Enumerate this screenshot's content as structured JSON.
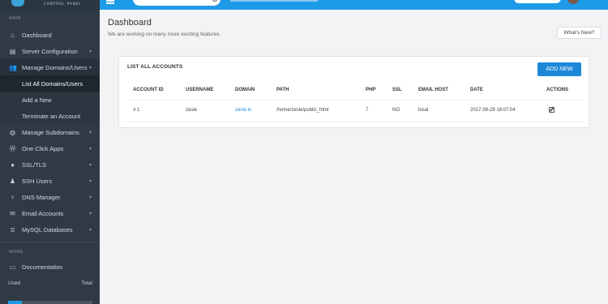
{
  "topbar": {
    "logo_subtitle": "CONTROL PANEL",
    "search_placeholder": ""
  },
  "sidebar": {
    "heading_main": "MAIN",
    "items": [
      {
        "label": "Dashboard",
        "icon": "home-icon"
      },
      {
        "label": "Server Configuration",
        "icon": "server-icon"
      },
      {
        "label": "Manage Domains/Users",
        "icon": "users-icon"
      },
      {
        "label": "Manage Subdomains",
        "icon": "globe-icon"
      },
      {
        "label": "One Click Apps",
        "icon": "wordpress-icon"
      },
      {
        "label": "SSL/TLS",
        "icon": "lock-icon"
      },
      {
        "label": "SSH Users",
        "icon": "user-secret-icon"
      },
      {
        "label": "DNS Manager",
        "icon": "sitemap-icon"
      },
      {
        "label": "Email Accounts",
        "icon": "envelope-icon"
      },
      {
        "label": "MySQL Databases",
        "icon": "database-icon"
      }
    ],
    "subitems": [
      {
        "label": "List All Domains/Users"
      },
      {
        "label": "Add a New"
      },
      {
        "label": "Terminate an Account"
      }
    ],
    "heading_more": "MORE",
    "documentation": "Documentation",
    "usage": {
      "used_label": "Used",
      "total_label": "Total",
      "fraction": 0.16
    }
  },
  "main": {
    "title": "Dashboard",
    "subtitle": "We are working on many more exciting features.",
    "whats_new": "What's New?"
  },
  "card": {
    "title": "LIST ALL ACCOUNTS",
    "add_button": "ADD NEW",
    "headers": [
      "ACCOUNT ID",
      "USERNAME",
      "DOMAIN",
      "PATH",
      "PHP",
      "SSL",
      "EMAIL HOST",
      "DATE",
      "ACTIONS"
    ],
    "rows": [
      {
        "id": "# 1",
        "username": "zesle",
        "domain": "zesle.in",
        "path": "/home/zesle/public_html",
        "php": "7",
        "ssl": "NO",
        "email_host": "local",
        "date": "2017-09-29 16:07:04"
      }
    ]
  },
  "colors": {
    "topbar": "#1e9be8",
    "sidebar": "#2f3a45",
    "accent": "#1e88d8"
  }
}
